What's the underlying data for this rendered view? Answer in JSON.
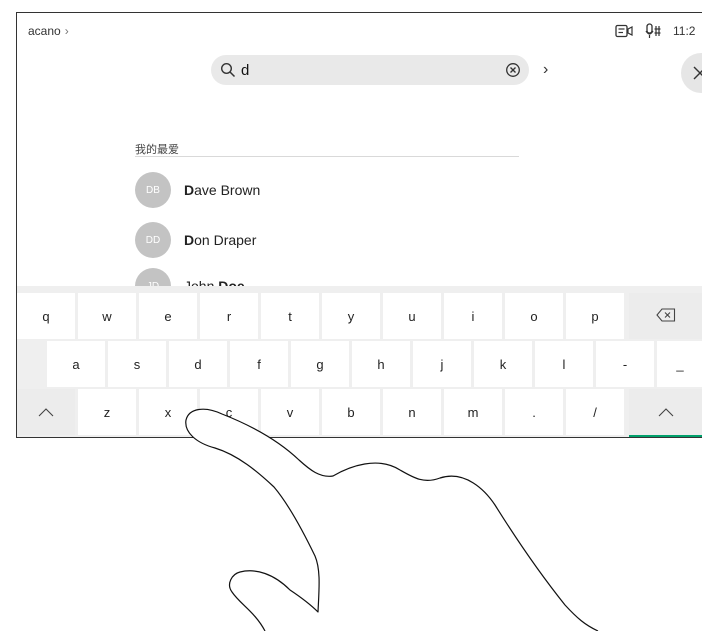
{
  "topbar": {
    "breadcrumb": "acano",
    "breadcrumb_chevron": "›",
    "clock": "11:2"
  },
  "search": {
    "value": "d",
    "placeholder": ""
  },
  "next_label": "›",
  "favorites": {
    "title": "我的最爱",
    "contacts": [
      {
        "initials": "DB",
        "match": "D",
        "rest": "ave Brown"
      },
      {
        "initials": "DD",
        "match": "D",
        "rest": "on Draper"
      },
      {
        "initials": "JD",
        "match": "John ",
        "rest": "Doe"
      }
    ]
  },
  "keyboard": {
    "row1": [
      "q",
      "w",
      "e",
      "r",
      "t",
      "y",
      "u",
      "i",
      "o",
      "p"
    ],
    "row2": [
      "a",
      "s",
      "d",
      "f",
      "g",
      "h",
      "j",
      "k",
      "l",
      "-",
      "_"
    ],
    "row3": [
      "z",
      "x",
      "c",
      "v",
      "b",
      "n",
      "m",
      ".",
      "/"
    ]
  },
  "icons": [
    "search-icon",
    "clear-icon",
    "close-icon",
    "chevron-right-icon",
    "backspace-icon",
    "shift-icon",
    "self-view-icon",
    "microphone-icon"
  ],
  "colors": {
    "accent": "#00a06b",
    "avatar": "#c3c3c3"
  }
}
